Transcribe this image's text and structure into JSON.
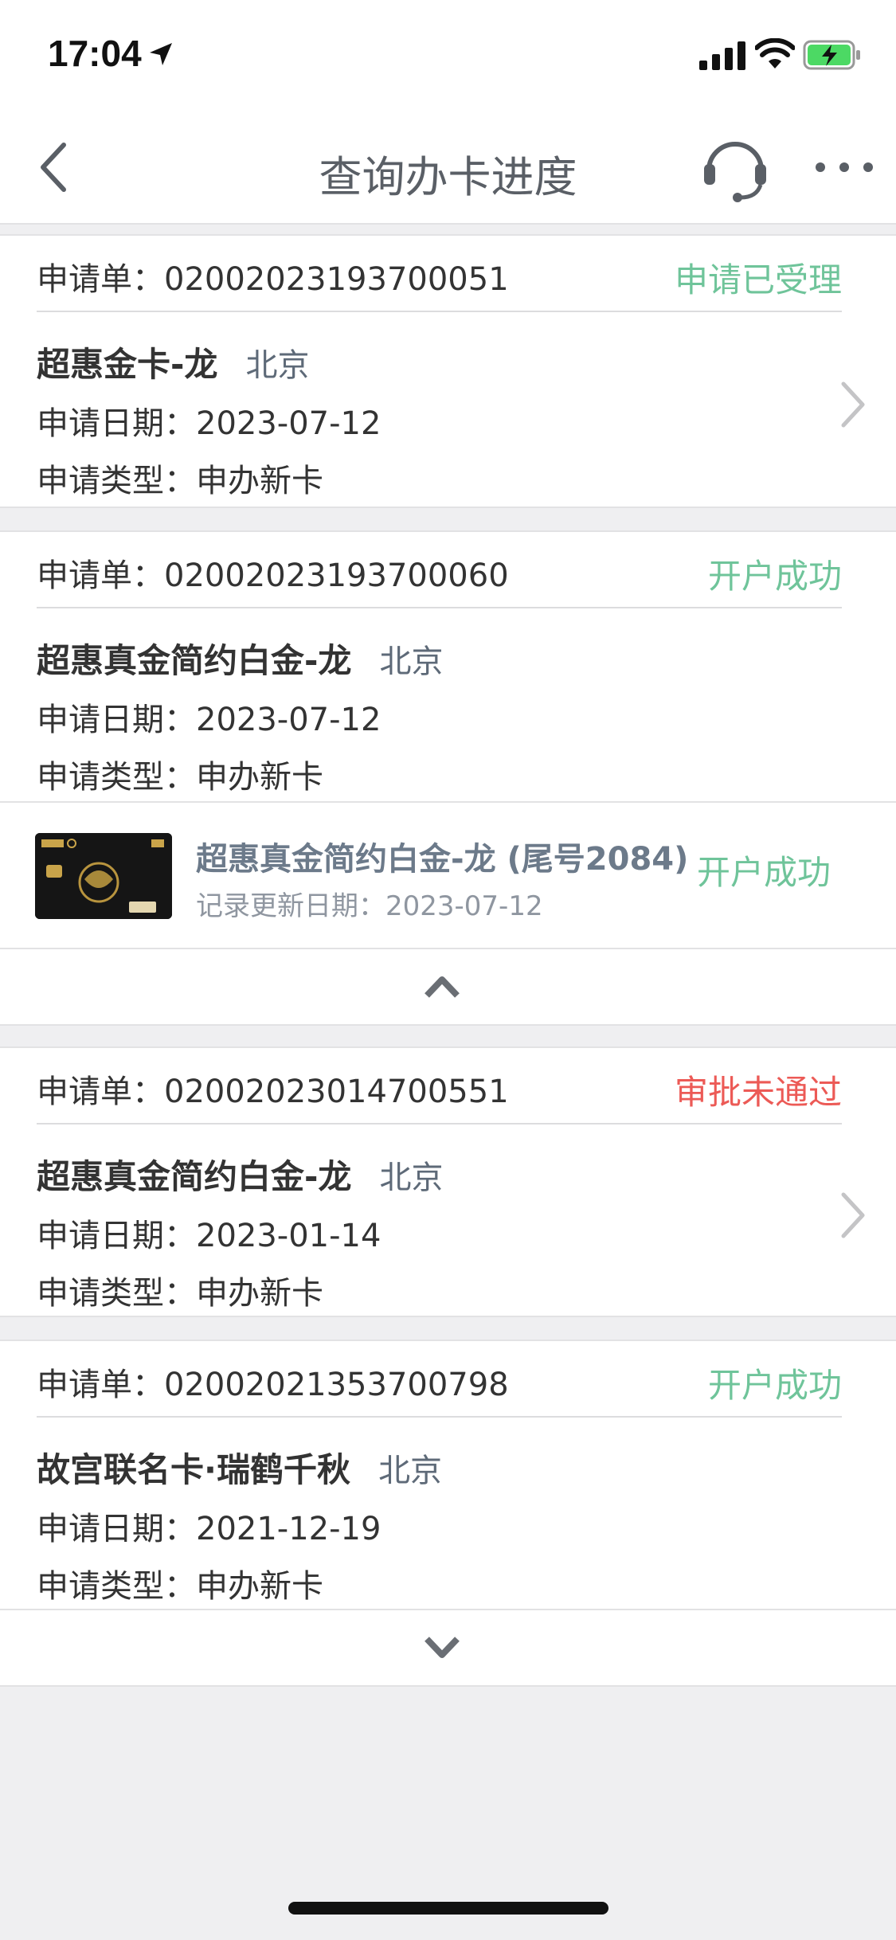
{
  "status_bar": {
    "time": "17:04"
  },
  "nav": {
    "title": "查询办卡进度"
  },
  "applications": [
    {
      "label": "申请单：",
      "number": "02002023193700051",
      "status": "申请已受理",
      "card_name": "超惠金卡-龙",
      "city": "北京",
      "date_line": "申请日期：2023-07-12",
      "type_line": "申请类型：申办新卡"
    },
    {
      "label": "申请单：",
      "number": "02002023193700060",
      "status": "开户成功",
      "card_name": "超惠真金简约白金-龙",
      "city": "北京",
      "date_line": "申请日期：2023-07-12",
      "type_line": "申请类型：申办新卡",
      "issued_card": {
        "name": "超惠真金简约白金-龙 (尾号2084)",
        "update_line": "记录更新日期：2023-07-12",
        "status": "开户成功"
      }
    },
    {
      "label": "申请单：",
      "number": "02002023014700551",
      "status": "审批未通过",
      "card_name": "超惠真金简约白金-龙",
      "city": "北京",
      "date_line": "申请日期：2023-01-14",
      "type_line": "申请类型：申办新卡"
    },
    {
      "label": "申请单：",
      "number": "02002021353700798",
      "status": "开户成功",
      "card_name": "故宫联名卡·瑞鹤千秋",
      "city": "北京",
      "date_line": "申请日期：2021-12-19",
      "type_line": "申请类型：申办新卡"
    }
  ],
  "colors": {
    "status_success": "#6fc49a",
    "status_rejected": "#ec5a56",
    "page_background": "#efeff1"
  },
  "icons": [
    "location-arrow-icon",
    "signal-icon",
    "wifi-icon",
    "battery-charging-icon",
    "back-chevron-icon",
    "headset-icon",
    "more-dots-icon",
    "chevron-right-icon",
    "chevron-up-icon",
    "chevron-down-icon"
  ]
}
